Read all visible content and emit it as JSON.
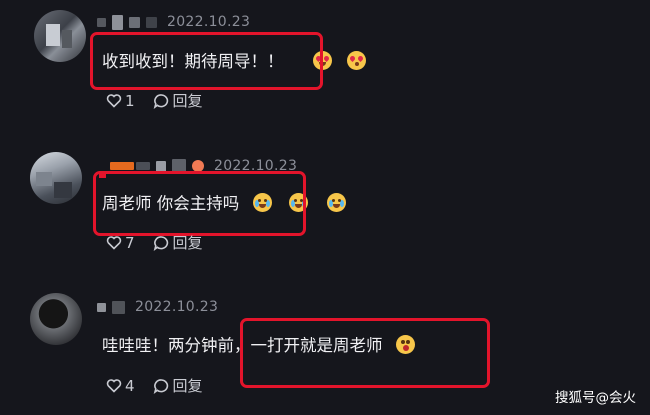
{
  "comments": [
    {
      "date": "2022.10.23",
      "text": "收到收到！期待周导！！",
      "emojis": [
        "heart-eyes-emoji",
        "blush-kiss-emoji"
      ],
      "likes": "1",
      "reply_label": "回复"
    },
    {
      "date": "2022.10.23",
      "text": "周老师 你会主持吗",
      "emojis": [
        "crying-laugh-emoji",
        "crying-laugh-emoji",
        "crying-laugh-emoji"
      ],
      "likes": "7",
      "reply_label": "回复"
    },
    {
      "date": "2022.10.23",
      "text": "哇哇哇！两分钟前，一打开就是周老师",
      "emojis": [
        "shocked-emoji"
      ],
      "likes": "4",
      "reply_label": "回复"
    }
  ],
  "watermark": "搜狐号@会火",
  "colors": {
    "background": "#15161c",
    "highlight_box": "#e3142b",
    "date_text": "#8c8f99"
  }
}
